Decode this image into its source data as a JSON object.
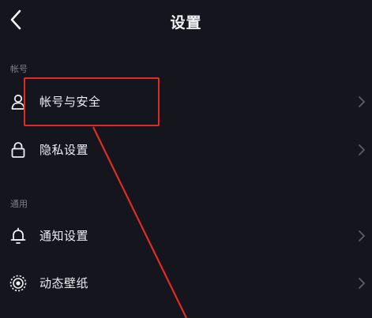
{
  "header": {
    "title": "设置",
    "back_icon": "back-chevron-icon"
  },
  "sections": [
    {
      "label": "帐号",
      "items": [
        {
          "label": "帐号与安全",
          "icon": "person-icon"
        },
        {
          "label": "隐私设置",
          "icon": "lock-icon"
        }
      ]
    },
    {
      "label": "通用",
      "items": [
        {
          "label": "通知设置",
          "icon": "bell-icon"
        },
        {
          "label": "动态壁纸",
          "icon": "live-wallpaper-icon"
        }
      ]
    }
  ],
  "colors": {
    "background": "#15161d",
    "text": "#eeeef1",
    "section_label": "#7d7f88",
    "chevron": "#5c5e66",
    "annotation": "#e32b22"
  }
}
